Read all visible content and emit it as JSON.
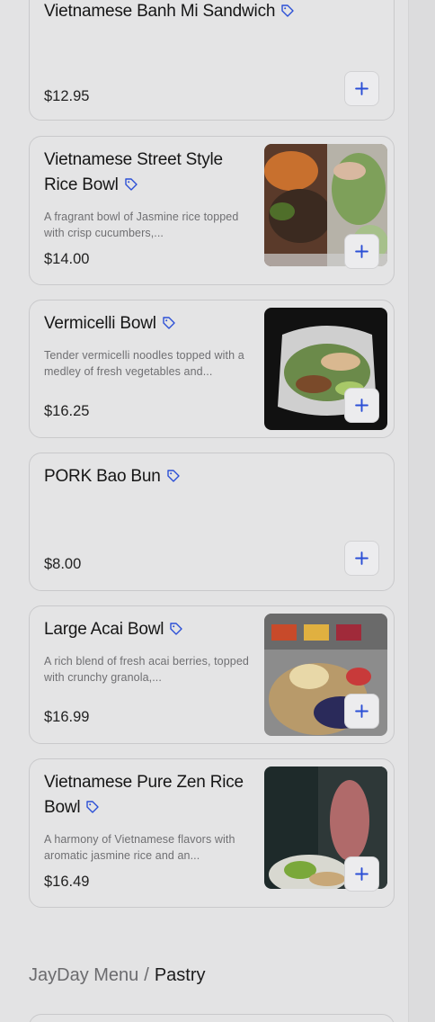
{
  "menu": {
    "items": [
      {
        "name": "Vietnamese Banh Mi Sandwich",
        "description": "",
        "price": "$12.95"
      },
      {
        "name": "Vietnamese Street Style Rice Bowl",
        "description": "A fragrant bowl of Jasmine rice topped with crisp cucumbers,...",
        "price": "$14.00"
      },
      {
        "name": "Vermicelli Bowl",
        "description": "Tender vermicelli noodles topped with a medley of fresh vegetables and...",
        "price": "$16.25"
      },
      {
        "name": "PORK Bao Bun",
        "description": "",
        "price": "$8.00"
      },
      {
        "name": "Large Acai Bowl",
        "description": "A rich blend of fresh acai berries, topped with crunchy granola,...",
        "price": "$16.99"
      },
      {
        "name": "Vietnamese Pure Zen Rice Bowl",
        "description": "A harmony of Vietnamese flavors with aromatic jasmine rice and an...",
        "price": "$16.49"
      }
    ]
  },
  "breadcrumb": {
    "root": "JayDay Menu",
    "separator": "/",
    "current": "Pastry"
  },
  "colors": {
    "accent": "#2b4fd6",
    "background": "#e3e3e4",
    "card_border": "#c9c9cb"
  },
  "icons": {
    "tag": "tag-icon",
    "add": "plus-icon"
  }
}
